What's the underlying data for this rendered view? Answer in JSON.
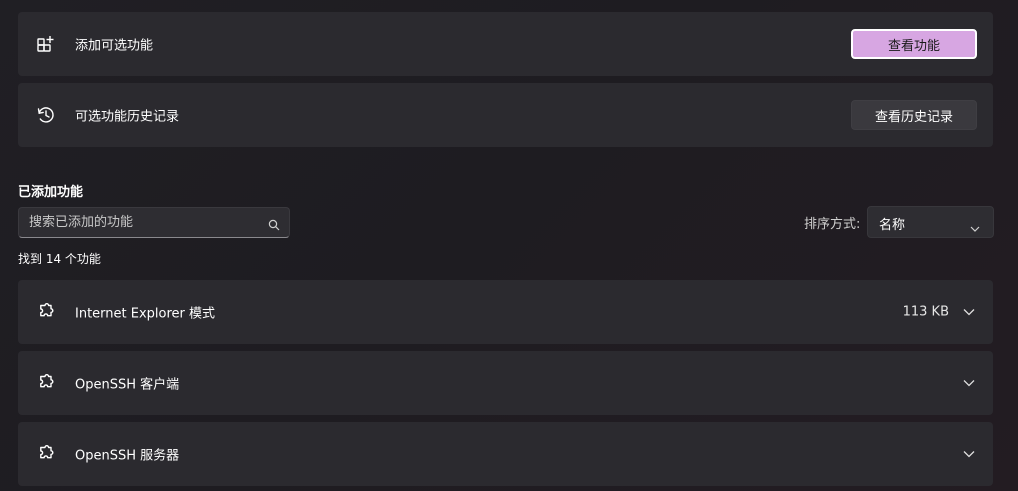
{
  "optional_features": {
    "add": {
      "label": "添加可选功能",
      "button_label": "查看功能",
      "icon": "add-apps-icon"
    },
    "history": {
      "label": "可选功能历史记录",
      "button_label": "查看历史记录",
      "icon": "history-icon"
    }
  },
  "installed": {
    "section_title": "已添加功能",
    "search_placeholder": "搜索已添加的功能",
    "sort_label": "排序方式:",
    "sort_value": "名称",
    "found_text": "找到 14 个功能",
    "features": [
      {
        "name": "Internet Explorer 模式",
        "size": "113 KB",
        "icon": "puzzle-icon"
      },
      {
        "name": "OpenSSH 客户端",
        "size": "",
        "icon": "puzzle-icon"
      },
      {
        "name": "OpenSSH 服务器",
        "size": "",
        "icon": "puzzle-icon"
      }
    ]
  },
  "colors": {
    "accent": "#d7a6e2",
    "card": "#2b2a2f",
    "background": "#201f24"
  }
}
